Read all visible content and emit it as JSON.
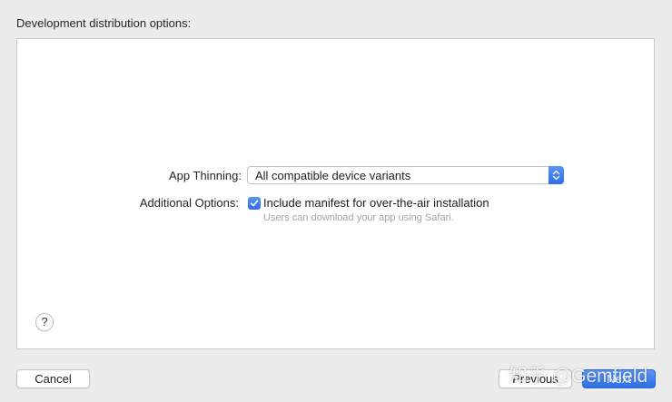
{
  "header": {
    "title": "Development distribution options:"
  },
  "form": {
    "app_thinning": {
      "label": "App Thinning:",
      "selected_value": "All compatible device variants"
    },
    "additional_options": {
      "label": "Additional Options:",
      "manifest_checkbox": {
        "label": "Include manifest for over-the-air installation",
        "checked": true,
        "hint": "Users can download your app using Safari."
      }
    }
  },
  "footer": {
    "help_label": "?",
    "cancel_label": "Cancel",
    "previous_label": "Previous",
    "next_label": "Next"
  },
  "watermark": {
    "text": "知乎 @Gemfield"
  },
  "colors": {
    "accent": "#3478f6",
    "window_bg": "#ececec",
    "panel_bg": "#ffffff",
    "hint_text": "#a6a6a6"
  },
  "icons": {
    "select_arrows": "up-down-chevron-icon",
    "checkbox_mark": "checkmark-icon"
  }
}
